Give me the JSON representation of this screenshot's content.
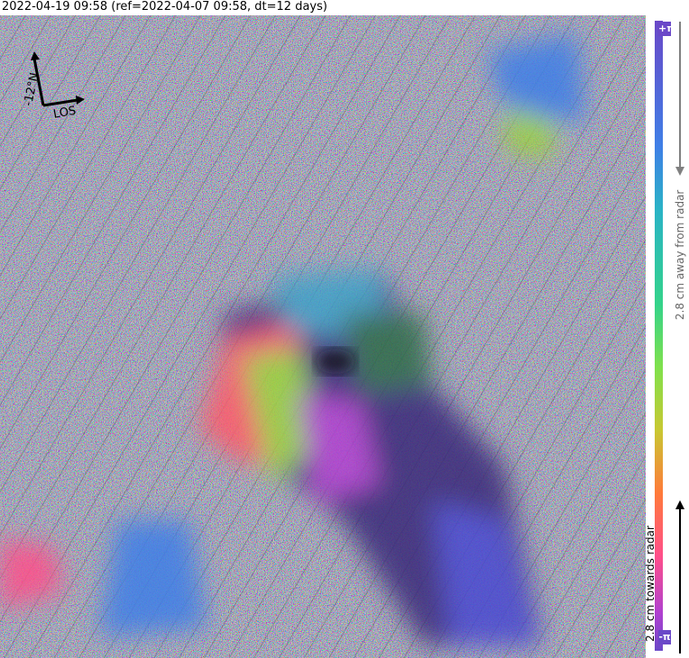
{
  "title": "2022-04-19 09:58 (ref=2022-04-07 09:58, dt=12 days)",
  "compass": {
    "north_label": "-12°N",
    "los_label": "LOS"
  },
  "colorbar": {
    "top_label": "+π",
    "bottom_label": "-π",
    "away_label": "2.8 cm away from radar",
    "towards_label": "2.8 cm towards radar"
  },
  "colors": {
    "violet": "#6a48c8",
    "blue": "#3f7fe6",
    "cyan": "#2ab3c6",
    "green": "#34d38a",
    "yellow": "#c8c832",
    "orange": "#ff7a3a",
    "magenta": "#ff4f8a",
    "purple": "#b040d0"
  }
}
